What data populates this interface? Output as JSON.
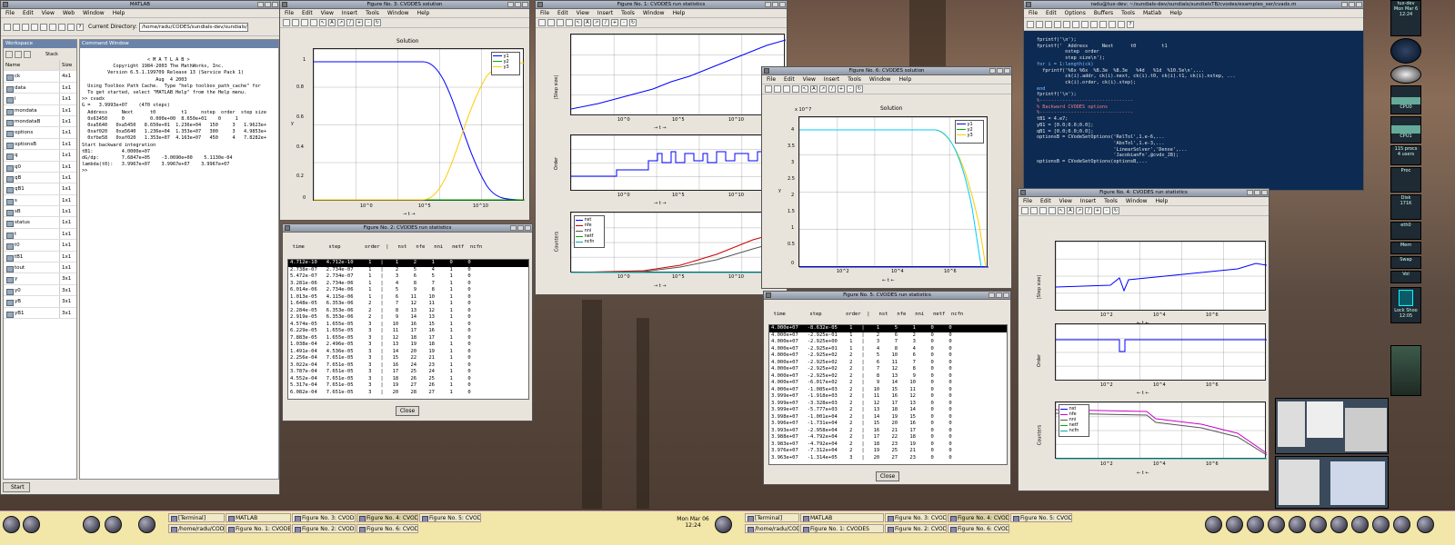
{
  "matlab": {
    "title": "MATLAB",
    "menu": [
      "File",
      "Edit",
      "View",
      "Web",
      "Window",
      "Help"
    ],
    "curdir_label": "Current Directory:",
    "curdir_value": "/home/radu/CODES/sundials-dev/sundials/sundialsTB/cvodes/examples_ser",
    "workspace_title": "Workspace",
    "stack_label": "Stack",
    "cmd_title": "Command Window",
    "ws_headers": [
      "Name",
      "Size"
    ],
    "ws_rows": [
      [
        "ck",
        "4x1"
      ],
      [
        "data",
        "1x1"
      ],
      [
        "i",
        "1x1"
      ],
      [
        "mondata",
        "1x1"
      ],
      [
        "mondataB",
        "1x1"
      ],
      [
        "options",
        "1x1"
      ],
      [
        "optionsB",
        "1x1"
      ],
      [
        "q",
        "1x1"
      ],
      [
        "q0",
        "1x1"
      ],
      [
        "qB",
        "1x1"
      ],
      [
        "qB1",
        "1x1"
      ],
      [
        "s",
        "1x1"
      ],
      [
        "sB",
        "1x1"
      ],
      [
        "status",
        "1x1"
      ],
      [
        "t",
        "1x1"
      ],
      [
        "t0",
        "1x1"
      ],
      [
        "tB1",
        "1x1"
      ],
      [
        "tout",
        "1x1"
      ],
      [
        "y",
        "3x1"
      ],
      [
        "y0",
        "3x1"
      ],
      [
        "yB",
        "3x1"
      ],
      [
        "yB1",
        "3x1"
      ]
    ],
    "cmd_lines": [
      "                       < M A T L A B >",
      "           Copyright 1984-2003 The MathWorks, Inc.",
      "         Version 6.5.1.199709 Release 13 (Service Pack 1)",
      "                          Aug  4 2003",
      "",
      "",
      "  Using Toolbox Path Cache.  Type \"help toolbox_path_cache\" for",
      "",
      "  To get started, select \"MATLAB Help\" from the Help menu.",
      "",
      ">> cvadx",
      "G =   3.9993e+07    (470 steps)",
      "",
      "  Address     Next      t0         t1     nstep  order  step size",
      "  0x63450     0         0.000e+00  8.650e+01    0     1   ",
      "  0xa5640   0xa5450   8.650e+01  1.236e+04   150     3   1.9623e+",
      "  0xaf020   0xa5640   1.236e+04  1.353e+07   300     3   4.9853e+",
      "  0xfbe58   0xaf020   1.353e+07  4.163e+07   450     4   7.8282e+",
      "",
      "Start backward integration",
      "tB1:          4.0000e+07",
      "dG/dp:        7.6847e+05    -3.0690e+00    5.1130e-04",
      "lambda(t0):   3.9967e+07    3.9967e+07    3.9967e+07",
      "",
      ">>"
    ],
    "start_label": "Start"
  },
  "fig3": {
    "title": "Figure No. 3: CVODES solution",
    "menu": [
      "File",
      "Edit",
      "View",
      "Insert",
      "Tools",
      "Window",
      "Help"
    ],
    "plot_title": "Solution",
    "xlabel": "t",
    "ylabel": "y",
    "legend": [
      "y1",
      "y2",
      "y3"
    ],
    "yticks": [
      "1",
      "0.8",
      "0.6",
      "0.4",
      "0.2",
      "0"
    ],
    "xticks": [
      "10^0",
      "10^5",
      "10^10"
    ]
  },
  "fig1": {
    "title": "Figure No. 1: CVODES run statistics",
    "menu": [
      "File",
      "Edit",
      "View",
      "Insert",
      "Tools",
      "Window",
      "Help"
    ],
    "ylabel1": "|Step size|",
    "ylabel2": "Order",
    "ylabel3": "Counters",
    "xlabel": "t",
    "legend": [
      "nst",
      "nfe",
      "nni",
      "netf",
      "ncfn"
    ],
    "xticks": [
      "10^0",
      "10^5",
      "10^10"
    ]
  },
  "fig6": {
    "title": "Figure No. 6: CVODES solution",
    "menu": [
      "File",
      "Edit",
      "View",
      "Insert",
      "Tools",
      "Window",
      "Help"
    ],
    "plot_title": "Solution",
    "exp_label": "x 10^7",
    "xlabel": "t",
    "ylabel": "y",
    "legend": [
      "y1",
      "y2",
      "y3"
    ],
    "yticks": [
      "4",
      "3.5",
      "3",
      "2.5",
      "2",
      "1.5",
      "1",
      "0.5",
      "0"
    ],
    "xticks": [
      "10^2",
      "10^4",
      "10^6"
    ]
  },
  "fig4": {
    "title": "Figure No. 4: CVODES run statistics",
    "menu": [
      "File",
      "Edit",
      "View",
      "Insert",
      "Tools",
      "Window",
      "Help"
    ],
    "ylabel1": "|Step size|",
    "ylabel2": "Order",
    "ylabel3": "Counters",
    "xlabel": "t",
    "legend": [
      "nst",
      "nfe",
      "nni",
      "netf",
      "ncfn"
    ],
    "xticks": [
      "10^2",
      "10^4",
      "10^6"
    ]
  },
  "fig2": {
    "title": "Figure No. 2: CVODES run statistics",
    "header": "  time        step        order  |   nst   nfe   nni   netf  ncfn",
    "close": "Close",
    "rows": [
      "4.712e-10   4.712e-10     1   |    1     2     1     0     0",
      "2.738e-07   2.734e-07     1   |    2     5     4     1     0",
      "5.472e-07   2.734e-07     1   |    3     6     5     1     0",
      "3.281e-06   2.734e-06     1   |    4     8     7     1     0",
      "6.014e-06   2.734e-06     1   |    5     9     8     1     0",
      "1.013e-05   4.115e-06     1   |    6    11    10     1     0",
      "1.648e-05   6.353e-06     2   |    7    12    11     1     0",
      "2.284e-05   6.353e-06     2   |    8    13    12     1     0",
      "2.919e-05   6.353e-06     2   |    9    14    13     1     0",
      "4.574e-05   1.655e-05     3   |   10    16    15     1     0",
      "6.229e-05   1.655e-05     3   |   11    17    16     1     0",
      "7.883e-05   1.655e-05     3   |   12    18    17     1     0",
      "1.038e-04   2.496e-05     3   |   13    19    18     1     0",
      "1.491e-04   4.536e-05     3   |   14    20    19     1     0",
      "2.256e-04   7.651e-05     3   |   15    22    21     1     0",
      "3.022e-04   7.651e-05     3   |   16    24    23     1     0",
      "3.787e-04   7.651e-05     3   |   17    25    24     1     0",
      "4.552e-04   7.651e-05     3   |   18    26    25     1     0",
      "5.317e-04   7.651e-05     3   |   19    27    26     1     0",
      "6.082e-04   7.651e-05     3   |   20    28    27     1     0"
    ]
  },
  "fig5": {
    "title": "Figure No. 5: CVODES run statistics",
    "header": "  time        step        order  |   nst   nfe   nni   netf  ncfn",
    "close": "Close",
    "rows": [
      "4.000e+07   -8.632e-05    1   |    1     5     1     0     0",
      "4.000e+07   -2.925e-01    1   |    2     6     2     0     0",
      "4.000e+07   -2.925e+00    1   |    3     7     3     0     0",
      "4.000e+07   -2.925e+01    1   |    4     8     4     0     0",
      "4.000e+07   -2.925e+02    2   |    5    10     6     0     0",
      "4.000e+07   -2.925e+02    2   |    6    11     7     0     0",
      "4.000e+07   -2.925e+02    2   |    7    12     8     0     0",
      "4.000e+07   -2.925e+02    2   |    8    13     9     0     0",
      "4.000e+07   -6.017e+02    2   |    9    14    10     0     0",
      "4.000e+07   -1.085e+03    2   |   10    15    11     0     0",
      "3.999e+07   -1.918e+03    2   |   11    16    12     0     0",
      "3.999e+07   -3.328e+03    2   |   12    17    13     0     0",
      "3.999e+07   -5.777e+03    2   |   13    18    14     0     0",
      "3.998e+07   -1.001e+04    2   |   14    19    15     0     0",
      "3.996e+07   -1.731e+04    2   |   15    20    16     0     0",
      "3.993e+07   -2.958e+04    2   |   16    21    17     0     0",
      "3.988e+07   -4.792e+04    2   |   17    22    18     0     0",
      "3.983e+07   -4.792e+04    2   |   18    23    19     0     0",
      "3.976e+07   -7.312e+04    2   |   19    25    21     0     0",
      "3.963e+07   -1.314e+05    3   |   20    27    23     0     0"
    ]
  },
  "emacs": {
    "title": "radu@tux-dev: ~/sundials-dev/sundials/sundialsTB/cvodes/examples_ser/cvadx.m",
    "menu": [
      "File",
      "Edit",
      "Options",
      "Buffers",
      "Tools",
      "Matlab",
      "Help"
    ],
    "lines": [
      "fprintf('\\n');",
      "fprintf('  Address     Next      t0         t1",
      "          nstep  order   ",
      "          step size\\n');",
      "for i = 1:length(ck)",
      "  fprintf('%6x %6x  %8.3e  %8.3e   %4d   %1d  %10.5e\\n',...",
      "          ck(i).addr, ck(i).next, ck(i).t0, ck(i).t1, ck(i).nstep, ...",
      "          ck(i).order, ck(i).step);",
      "end",
      "fprintf('\\n');",
      "",
      "%---------------------------------",
      "% Backward CVODES options",
      "%---------------------------------",
      "",
      "tB1 = 4.e7;",
      "yB1 = [0.0;0.0;0.0];",
      "qB1 = [0.0;0.0;0.0];",
      "",
      "optionsB = CVodeSetOptions('RelTol',1.e-6,...",
      "                           'AbsTol',1.e-3,...",
      "                           'LinearSolver','Dense',...",
      "                           'JacobianFn',@cvdx_JB);",
      "",
      "optionsB = CVodeSetOptions(optionsB,..."
    ]
  },
  "sysmon": {
    "clock_top": "tux-dev",
    "date": "Mon Mar 6",
    "time": "12:24",
    "cpu0": "CPU0",
    "cpu1": "CPU1",
    "procs": "115 procs",
    "users": "4 users",
    "proc": "Proc",
    "disk": "Disk",
    "disk_val": "171K",
    "eth0": "eth0",
    "mem": "Mem",
    "swap": "Swap",
    "vol": "Vol",
    "lock": "Lock Shoo",
    "lock_time": "12:05"
  },
  "taskbar": {
    "left_tasks": [
      "[Terminal]",
      "MATLAB",
      "Figure No. 3: CVODE",
      "Figure No. 4: CVODE",
      "Figure No. 5: CVODE"
    ],
    "left_tasks2": [
      "/home/radu/CODES",
      "Figure No. 1: CVODE",
      "Figure No. 2: CVODE",
      "Figure No. 6: CVODE"
    ],
    "right_tasks": [
      "[Terminal]",
      "MATLAB",
      "Figure No. 3: CVODES",
      "Figure No. 4: CVODES",
      "Figure No. 5: CVODES"
    ],
    "right_tasks2": [
      "/home/radu/CODES/su",
      "Figure No. 1: CVODES",
      "Figure No. 2: CVODES",
      "Figure No. 6: CVODES"
    ],
    "clock": "Mon Mar 06",
    "clock_time": "12:24"
  }
}
